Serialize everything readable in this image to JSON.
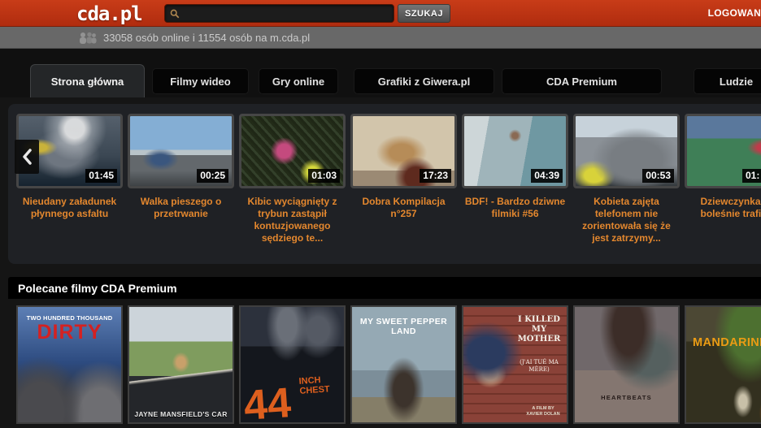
{
  "header": {
    "logo": "cda.pl",
    "search": {
      "placeholder": "",
      "value": "",
      "button": "SZUKAJ"
    },
    "login": "LOGOWANIE"
  },
  "online_bar": {
    "text": "33058 osób online i 11554 osób na m.cda.pl"
  },
  "nav": {
    "tabs": [
      {
        "label": "Strona główna",
        "active": true
      },
      {
        "label": "Filmy wideo",
        "active": false
      },
      {
        "label": "Gry online",
        "active": false
      },
      {
        "label": "Grafiki z Giwera.pl",
        "active": false
      },
      {
        "label": "CDA Premium",
        "active": false
      },
      {
        "label": "Ludzie",
        "active": false
      }
    ]
  },
  "carousel": {
    "prev_arrow": "previous",
    "videos": [
      {
        "title": "Nieudany załadunek płynnego asfaltu",
        "duration": "01:45",
        "art": "tanker-truck-steam"
      },
      {
        "title": "Walka pieszego o przetrwanie",
        "duration": "00:25",
        "art": "dashcam-road"
      },
      {
        "title": "Kibic wyciągnięty z trybun zastąpił kontuzjowanego sędziego te...",
        "duration": "01:03",
        "art": "football-crowd-referee"
      },
      {
        "title": "Dobra Kompilacja n°257",
        "duration": "17:23",
        "art": "dog-against-wall"
      },
      {
        "title": "BDF! - Bardzo dziwne filmiki #56",
        "duration": "04:39",
        "art": "pool-diving-board"
      },
      {
        "title": "Kobieta zajęta telefonem nie zorientowała się że jest zatrzymy...",
        "duration": "00:53",
        "art": "helmet-cam-gray-car"
      },
      {
        "title": "Dziewczynka od boleśnie trafio...",
        "duration": "01:",
        "art": "tennis-court"
      }
    ]
  },
  "premium": {
    "heading": "Polecane filmy CDA Premium",
    "posters": [
      {
        "top": "TWO HUNDRED THOUSAND",
        "title": "DIRTY"
      },
      {
        "title": "JAYNE MANSFIELD'S CAR"
      },
      {
        "big": "44",
        "small": "INCH CHEST"
      },
      {
        "title": "MY SWEET PEPPER LAND"
      },
      {
        "title": "I KILLED MY MOTHER",
        "sub": "(J'AI TUÉ MA MÈRE)",
        "credit": "A FILM BY XAVIER DOLAN"
      },
      {
        "title": "HEARTBEATS"
      },
      {
        "title": "MANDARINE"
      }
    ]
  },
  "colors": {
    "accent_red": "#b9300f",
    "title_orange": "#e3872e",
    "online_bar_gray": "#686868"
  }
}
